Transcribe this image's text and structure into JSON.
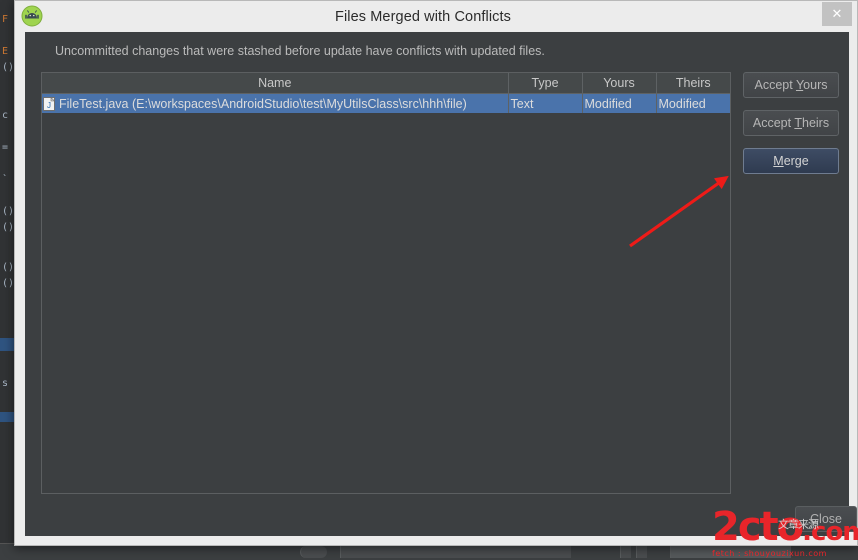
{
  "window": {
    "title": "Files Merged with Conflicts",
    "app_icon": "android-studio-icon",
    "close_icon": "✕"
  },
  "dialog": {
    "message": "Uncommitted changes that were stashed before update have conflicts with updated files."
  },
  "table": {
    "columns": [
      {
        "key": "name",
        "label": "Name"
      },
      {
        "key": "type",
        "label": "Type"
      },
      {
        "key": "yours",
        "label": "Yours"
      },
      {
        "key": "theirs",
        "label": "Theirs"
      }
    ],
    "rows": [
      {
        "icon": "java-file-icon",
        "name": "FileTest.java (E:\\workspaces\\AndroidStudio\\test\\MyUtilsClass\\src\\hhh\\file)",
        "type": "Text",
        "yours": "Modified",
        "theirs": "Modified",
        "selected": true
      }
    ]
  },
  "buttons": {
    "accept_yours": {
      "prefix": "Accept ",
      "mnemonic": "Y",
      "suffix": "ours"
    },
    "accept_theirs": {
      "prefix": "Accept ",
      "mnemonic": "T",
      "suffix": "heirs"
    },
    "merge": {
      "prefix": "",
      "mnemonic": "M",
      "suffix": "erge"
    },
    "close": "Close"
  },
  "annotation": {
    "arrow_color": "#ee1b18",
    "arrow_from": "630,246",
    "arrow_to": "727,177"
  },
  "watermark": {
    "brand": "2cto",
    "tld": ".com",
    "tagline": "fetch : shouyouzixun.com",
    "cjk": "文章来源"
  },
  "colors": {
    "dialog_chrome": "#ececec",
    "dialog_body": "#3c3f41",
    "selection_blue": "#4a73ab",
    "header_gray": "#45494a",
    "primary_button": "#3e4c64",
    "text_muted": "#bbbbbb",
    "watermark_red": "#e8252a"
  },
  "ide_background": {
    "code_lines": [
      "F",
      "E",
      "()",
      "",
      "c",
      "",
      "=",
      "",
      "`",
      "",
      "",
      "()",
      "()",
      "",
      "",
      "()",
      "()",
      "",
      "",
      "",
      "",
      "s e",
      "",
      ""
    ]
  }
}
